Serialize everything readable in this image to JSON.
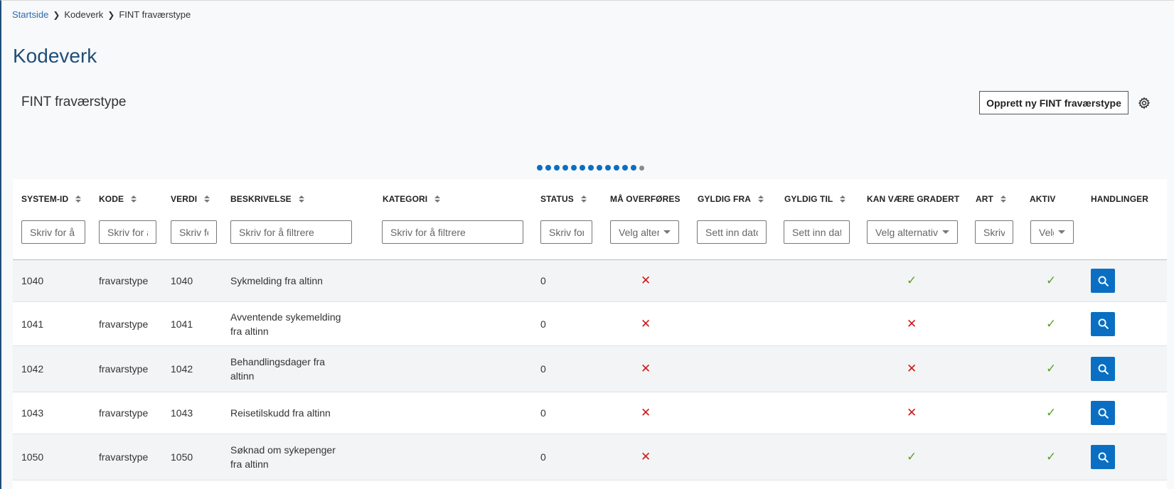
{
  "breadcrumb": {
    "home": "Startside",
    "level2": "Kodeverk",
    "current": "FINT fraværstype"
  },
  "page_title": "Kodeverk",
  "section_title": "FINT fraværstype",
  "create_button": "Opprett ny FINT fraværstype",
  "pager": {
    "active_dots": 12,
    "inactive_dots": 1
  },
  "columns": {
    "system_id": "SYSTEM-ID",
    "kode": "KODE",
    "verdi": "VERDI",
    "beskrivelse": "BESKRIVELSE",
    "kategori": "KATEGORI",
    "status": "STATUS",
    "ma_overfores": "MÅ OVERFØRES",
    "gyldig_fra": "GYLDIG FRA",
    "gyldig_til": "GYLDIG TIL",
    "kan_vaere_gradert": "KAN VÆRE GRADERT",
    "art": "ART",
    "aktiv": "AKTIV",
    "handlinger": "HANDLINGER"
  },
  "filters": {
    "system_id": "Skriv for å filtrere",
    "kode": "Skriv for å filtrere",
    "verdi": "Skriv for å filtrere",
    "beskrivelse": "Skriv for å filtrere",
    "kategori": "Skriv for å filtrere",
    "status": "Skriv for å filtrere",
    "ma_overfores": "Velg alternativ",
    "gyldig_fra": "Sett inn dato",
    "gyldig_til": "Sett inn dato",
    "kan_vaere_gradert": "Velg alternativ",
    "art": "Skriv for å filtrere",
    "aktiv": "Velg alternativ"
  },
  "rows": [
    {
      "id": "1040",
      "kode": "fravarstype",
      "verdi": "1040",
      "desc1": "Sykmelding fra altinn",
      "desc2": "",
      "status": "0",
      "ma": "x",
      "gradert": "check",
      "aktiv": "check"
    },
    {
      "id": "1041",
      "kode": "fravarstype",
      "verdi": "1041",
      "desc1": "Avventende sykemelding",
      "desc2": "fra altinn",
      "status": "0",
      "ma": "x",
      "gradert": "x",
      "aktiv": "check"
    },
    {
      "id": "1042",
      "kode": "fravarstype",
      "verdi": "1042",
      "desc1": "Behandlingsdager fra",
      "desc2": "altinn",
      "status": "0",
      "ma": "x",
      "gradert": "x",
      "aktiv": "check"
    },
    {
      "id": "1043",
      "kode": "fravarstype",
      "verdi": "1043",
      "desc1": "Reisetilskudd fra altinn",
      "desc2": "",
      "status": "0",
      "ma": "x",
      "gradert": "x",
      "aktiv": "check"
    },
    {
      "id": "1050",
      "kode": "fravarstype",
      "verdi": "1050",
      "desc1": "Søknad om sykepenger",
      "desc2": "fra altinn",
      "status": "0",
      "ma": "x",
      "gradert": "check",
      "aktiv": "check"
    }
  ],
  "colors": {
    "brand": "#1f4e79",
    "accent": "#0a6fc2",
    "check": "#5aa02c",
    "cross": "#d01717"
  }
}
